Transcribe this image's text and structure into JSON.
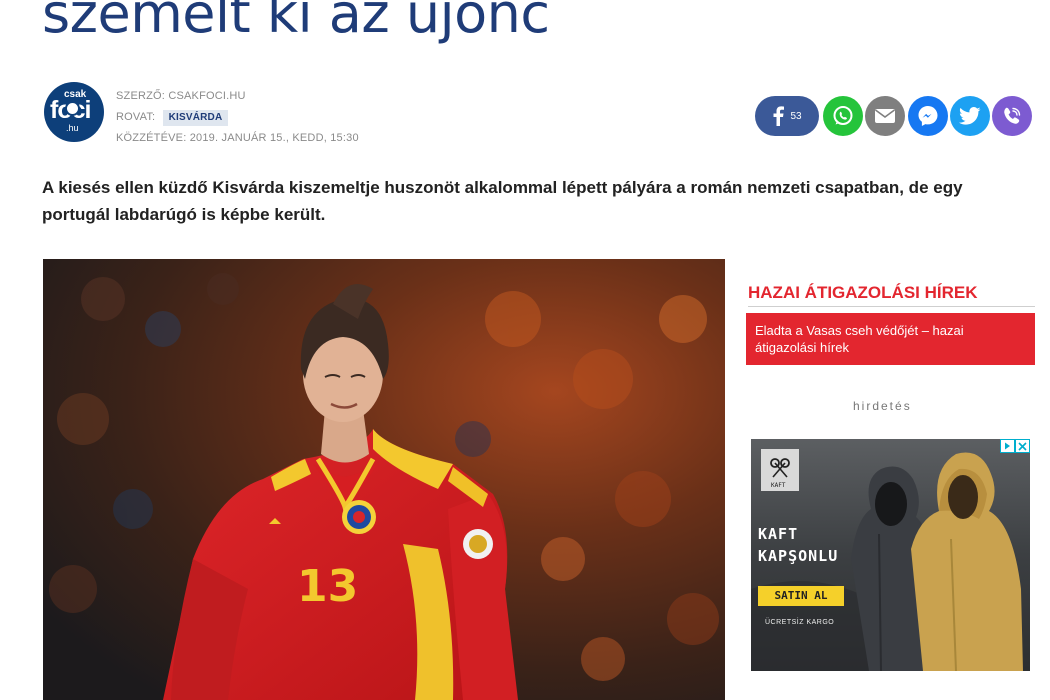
{
  "article": {
    "headline": "szemelt ki az újonc",
    "lead": "A kiesés ellen küzdő Kisvárda kiszemeltje huszonöt alkalommal lépett pályára a román nemzeti csapatban, de egy portugál labdarúgó is képbe került."
  },
  "logo": {
    "line1": "csak",
    "line2": "foci",
    "line3": ".hu"
  },
  "meta": {
    "author_label": "SZERZŐ: CSAKFOCI.HU",
    "section_label": "ROVAT:",
    "section_tag": "KISVÁRDA",
    "published": "KÖZZÉTÉVE: 2019. JANUÁR 15., KEDD, 15:30"
  },
  "share": {
    "facebook_count": "53",
    "icons": [
      "facebook-icon",
      "whatsapp-icon",
      "email-icon",
      "messenger-icon",
      "twitter-icon",
      "viber-icon"
    ],
    "colors": {
      "facebook": "#3b5998",
      "whatsapp": "#25c43b",
      "email": "#7f7f7f",
      "messenger": "#1678f2",
      "twitter": "#1da1f2",
      "viber": "#7d5bd1"
    }
  },
  "sidebar": {
    "title": "HAZAI ÁTIGAZOLÁSI HÍREK",
    "news_item": "Eladta a Vasas cseh védőjét – hazai átigazolási hírek",
    "accent": "#e3262f"
  },
  "ad": {
    "label": "hirdetés",
    "logo_text": "KAFT",
    "brand_line1": "KAFT",
    "brand_line2": "KAPŞONLU",
    "button": "SATIN AL",
    "shipping": "ÜCRETSİZ KARGO"
  },
  "photo": {
    "jersey_number": "13"
  }
}
